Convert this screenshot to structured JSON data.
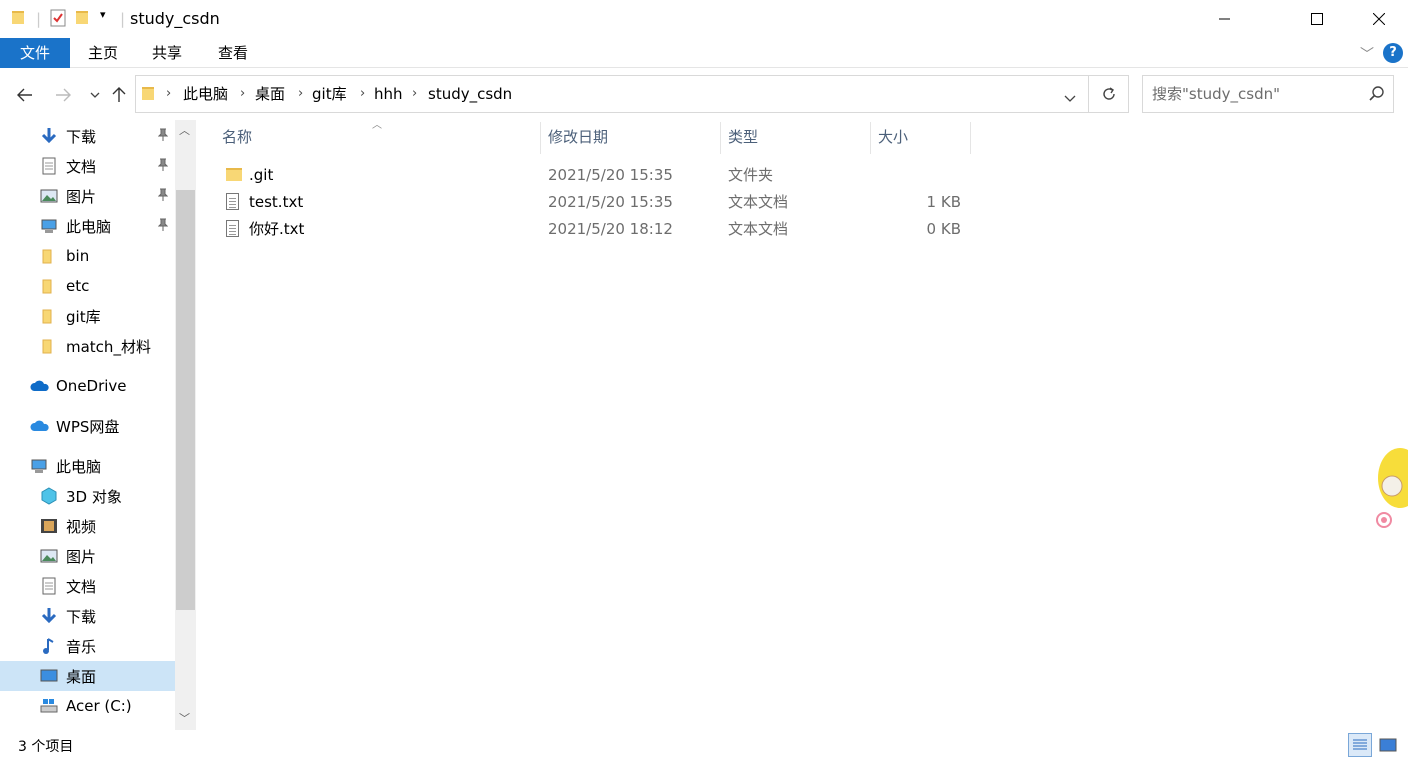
{
  "window": {
    "title": "study_csdn",
    "minimize": "—",
    "maximize": "☐",
    "close": "✕"
  },
  "ribbon": {
    "tabs": [
      "文件",
      "主页",
      "共享",
      "查看"
    ]
  },
  "address": {
    "crumbs": [
      "此电脑",
      "桌面",
      "git库",
      "hhh",
      "study_csdn"
    ],
    "search_placeholder": "搜索\"study_csdn\""
  },
  "sidebar": {
    "quick_access": [
      {
        "label": "下载",
        "icon": "download-arrow-icon",
        "pinned": true
      },
      {
        "label": "文档",
        "icon": "document-icon",
        "pinned": true
      },
      {
        "label": "图片",
        "icon": "pictures-icon",
        "pinned": true
      },
      {
        "label": "此电脑",
        "icon": "computer-icon",
        "pinned": true
      },
      {
        "label": "bin",
        "icon": "folder-icon",
        "pinned": false
      },
      {
        "label": "etc",
        "icon": "folder-icon",
        "pinned": false
      },
      {
        "label": "git库",
        "icon": "folder-icon",
        "pinned": false
      },
      {
        "label": "match_材料",
        "icon": "folder-icon",
        "pinned": false
      }
    ],
    "onedrive": "OneDrive",
    "wps": "WPS网盘",
    "this_pc": "此电脑",
    "pc_items": [
      {
        "label": "3D 对象",
        "icon": "3d-objects-icon"
      },
      {
        "label": "视频",
        "icon": "video-icon"
      },
      {
        "label": "图片",
        "icon": "pictures-icon"
      },
      {
        "label": "文档",
        "icon": "document-icon"
      },
      {
        "label": "下载",
        "icon": "download-arrow-icon"
      },
      {
        "label": "音乐",
        "icon": "music-note-icon"
      },
      {
        "label": "桌面",
        "icon": "desktop-icon",
        "selected": true
      },
      {
        "label": "Acer (C:)",
        "icon": "drive-icon"
      }
    ]
  },
  "columns": {
    "name": "名称",
    "modified": "修改日期",
    "type": "类型",
    "size": "大小"
  },
  "files": [
    {
      "name": ".git",
      "modified": "2021/5/20 15:35",
      "type": "文件夹",
      "size": "",
      "icon": "folder-icon"
    },
    {
      "name": "test.txt",
      "modified": "2021/5/20 15:35",
      "type": "文本文档",
      "size": "1 KB",
      "icon": "text-file-icon"
    },
    {
      "name": "你好.txt",
      "modified": "2021/5/20 18:12",
      "type": "文本文档",
      "size": "0 KB",
      "icon": "text-file-icon"
    }
  ],
  "status": {
    "count": "3 个项目"
  }
}
